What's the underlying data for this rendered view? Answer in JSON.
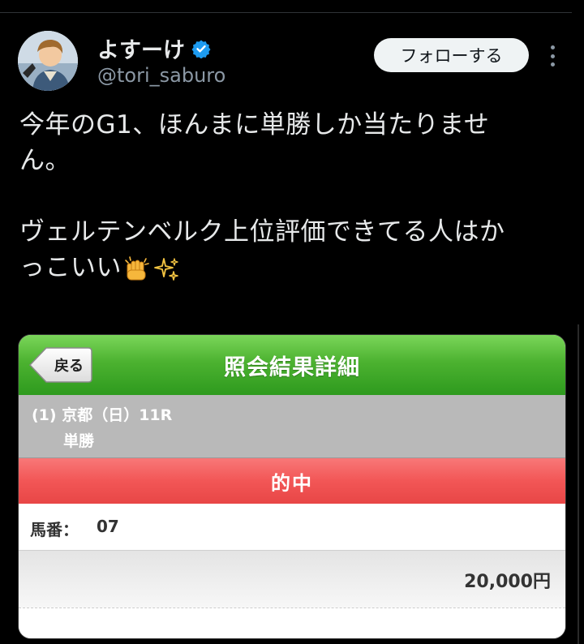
{
  "author": {
    "display_name": "よすーけ",
    "handle": "@tori_saburo",
    "verified": true,
    "avatar_icon": "user-avatar"
  },
  "actions": {
    "follow_label": "フォローする",
    "more_icon": "more-dots-icon"
  },
  "tweet": {
    "line1": "今年のG1、ほんまに単勝しか当たりませ",
    "line2": "ん。",
    "line3": "ヴェルテンベルク上位評価できてる人はか",
    "line4": "っこいい",
    "emojis": [
      "clapping-hands-emoji",
      "sparkles-emoji"
    ]
  },
  "embed": {
    "back_label": "戻る",
    "title": "照会結果詳細",
    "race_line1": "(1) 京都（日）11R",
    "race_line2": "単勝",
    "result": "的中",
    "horse_label": "馬番：",
    "horse_number": "07",
    "amount": "20,000円"
  },
  "colors": {
    "background": "#000000",
    "follow_button": "#eff3f4",
    "verified": "#1d9bf0",
    "header_green": "#4cb230",
    "hit_red": "#f25656"
  }
}
